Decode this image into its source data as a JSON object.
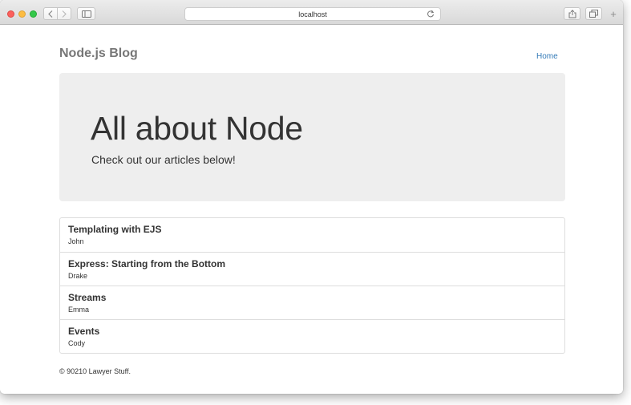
{
  "browser": {
    "url": "localhost"
  },
  "site": {
    "brand": "Node.js Blog",
    "nav": {
      "home_label": "Home"
    }
  },
  "jumbotron": {
    "title": "All about Node",
    "subtitle": "Check out our articles below!"
  },
  "articles": [
    {
      "title": "Templating with EJS",
      "author": "John"
    },
    {
      "title": "Express: Starting from the Bottom",
      "author": "Drake"
    },
    {
      "title": "Streams",
      "author": "Emma"
    },
    {
      "title": "Events",
      "author": "Cody"
    }
  ],
  "footer": {
    "text": "© 90210 Lawyer Stuff."
  },
  "colors": {
    "link": "#337ab7",
    "jumbotron_bg": "#eeeeee",
    "brand_text": "#777777"
  }
}
